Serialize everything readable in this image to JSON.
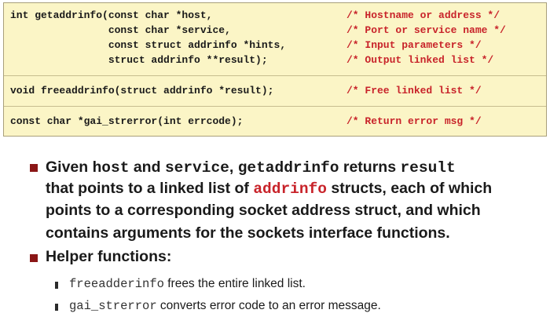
{
  "code_box": {
    "getaddrinfo_lines": [
      {
        "code": "int getaddrinfo(const char *host,",
        "comment": "/* Hostname or address */"
      },
      {
        "code": "                const char *service,",
        "comment": "/* Port or service name */"
      },
      {
        "code": "                const struct addrinfo *hints,",
        "comment": "/* Input parameters */"
      },
      {
        "code": "                struct addrinfo **result);",
        "comment": "/* Output linked list */"
      }
    ],
    "freeaddrinfo_line": {
      "code": "void freeaddrinfo(struct addrinfo *result);",
      "comment": "/* Free linked list */"
    },
    "gai_strerror_line": {
      "code": "const char *gai_strerror(int errcode);",
      "comment": "/* Return error msg */"
    }
  },
  "bullet1": {
    "prefix": "Given ",
    "host": "host",
    "and": " and ",
    "service": "service",
    "comma": ", ",
    "getaddrinfo": "getaddrinfo",
    "returns": "  returns ",
    "result": "result",
    "line2_pre": "that points to a linked list of ",
    "addrinfo": "addrinfo",
    "line2_post": " structs, each of which",
    "line3": "points to a corresponding socket address struct, and which",
    "line4": "contains arguments for the sockets interface functions."
  },
  "bullet2": {
    "title": "Helper functions:",
    "items": [
      {
        "code": "freeadderinfo",
        "text": " frees the entire linked list."
      },
      {
        "code": "gai_strerror",
        "text": " converts error code to an error message."
      }
    ]
  },
  "colors": {
    "comment": "#c8232a",
    "box": "#fbf5c6",
    "bullet": "#8a1616"
  }
}
